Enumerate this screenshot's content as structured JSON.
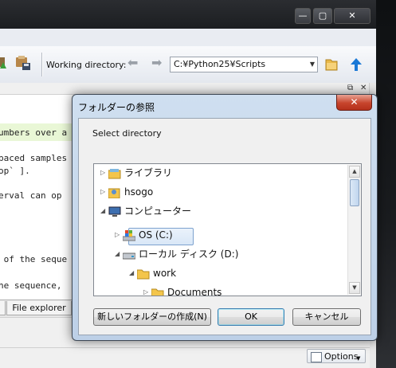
{
  "toolbar": {
    "working_directory_label": "Working directory:",
    "working_directory_value": "C:¥Python25¥Scripts"
  },
  "editor": {
    "lines": [
      "umbers over a",
      "paced samples",
      "op` ].",
      "erval can op",
      " of the seque",
      "he sequence,"
    ]
  },
  "tabs": {
    "file_explorer": "File explorer"
  },
  "status": {
    "options_label": "Options"
  },
  "dialog": {
    "title": "フォルダーの参照",
    "prompt": "Select directory",
    "tree": [
      {
        "label": "ライブラリ",
        "icon": "library-icon"
      },
      {
        "label": "hsogo",
        "icon": "user-folder-icon"
      },
      {
        "label": "コンピューター",
        "icon": "computer-icon"
      },
      {
        "label": "OS (C:)",
        "icon": "windows-drive-icon",
        "selected": true
      },
      {
        "label": "ローカル ディスク (D:)",
        "icon": "hard-drive-icon"
      },
      {
        "label": "work",
        "icon": "folder-icon"
      },
      {
        "label": "Documents",
        "icon": "folder-icon"
      }
    ],
    "buttons": {
      "new_folder": "新しいフォルダーの作成(N)",
      "ok": "OK",
      "cancel": "キャンセル"
    }
  },
  "colors": {
    "dialog_frame": "#bdd0e7",
    "close_red": "#c7442c",
    "selection": "#d9e7f7",
    "highlight_line": "#e9f7d6"
  }
}
